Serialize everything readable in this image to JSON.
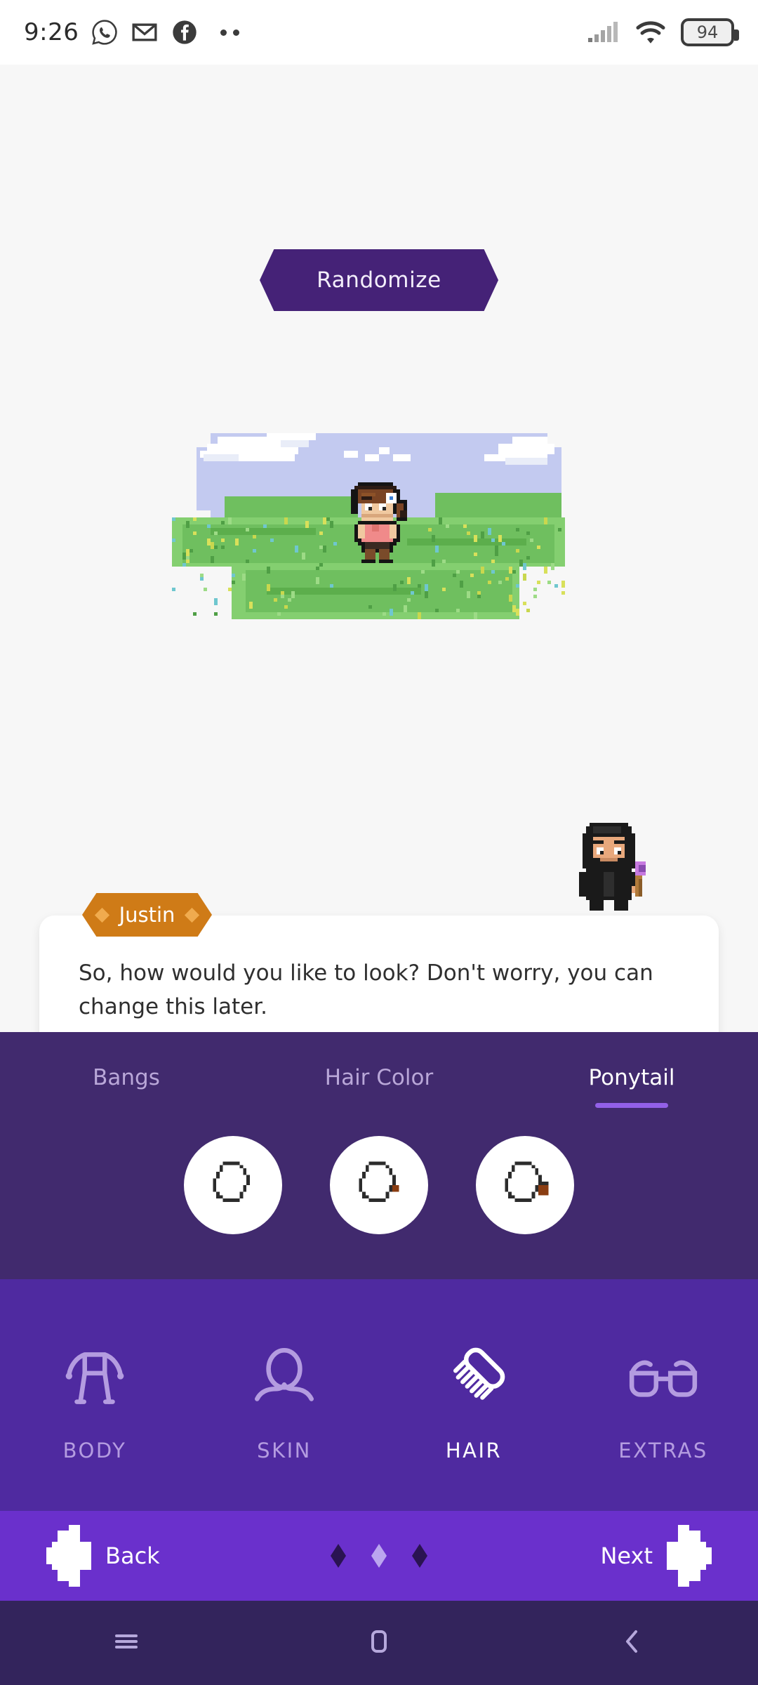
{
  "status_bar": {
    "time": "9:26",
    "left_icons": [
      "whatsapp-icon",
      "gmail-icon",
      "facebook-icon",
      "overflow-dots-icon"
    ],
    "right_icons": [
      "signal-bars-icon",
      "wifi-icon",
      "battery-icon"
    ],
    "battery_level": "94"
  },
  "stage": {
    "randomize_label": "Randomize",
    "avatar_alt": "player-avatar-sprite",
    "npc_alt": "npc-justin-sprite"
  },
  "dialogue": {
    "speaker": "Justin",
    "text": "So, how would you like to look? Don't worry, you can change this later."
  },
  "options_panel": {
    "tabs": [
      {
        "label": "Bangs",
        "active": false
      },
      {
        "label": "Hair Color",
        "active": false
      },
      {
        "label": "Ponytail",
        "active": true
      }
    ],
    "swatches": [
      {
        "name": "ponytail-option-none",
        "selected": false
      },
      {
        "name": "ponytail-option-short",
        "selected": false
      },
      {
        "name": "ponytail-option-long",
        "selected": false
      }
    ]
  },
  "categories": [
    {
      "label": "BODY",
      "icon": "body-icon",
      "active": false
    },
    {
      "label": "SKIN",
      "icon": "head-shoulders-icon",
      "active": false
    },
    {
      "label": "HAIR",
      "icon": "comb-icon",
      "active": true
    },
    {
      "label": "EXTRAS",
      "icon": "glasses-icon",
      "active": false
    }
  ],
  "nav": {
    "back_label": "Back",
    "next_label": "Next",
    "page_dots": [
      {
        "active": false
      },
      {
        "active": true
      },
      {
        "active": false
      }
    ]
  },
  "android_nav": {
    "recents": "recents-icon",
    "home": "home-icon",
    "back": "back-chevron-icon"
  },
  "colors": {
    "panel_dark_purple": "#412a6e",
    "category_purple": "#4f2aa0",
    "nav_purple": "#6a30cc",
    "android_nav_purple": "#33245c",
    "randomize_purple": "#452277",
    "badge_orange": "#cf7b17",
    "accent_underline": "#9360e8",
    "page_bg": "#f7f7f7"
  }
}
